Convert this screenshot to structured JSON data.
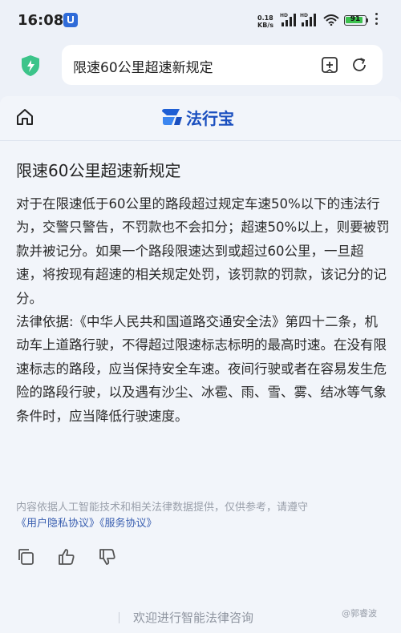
{
  "status_bar": {
    "time": "16:08",
    "net_speed_value": "0.18",
    "net_speed_unit": "KB/s",
    "sim1_label": "HD",
    "sim2_label": "HD",
    "battery_level": "91",
    "battery_fraction": 0.91,
    "battery_color": "#3cc14e"
  },
  "browser": {
    "url_text": "限速60公里超速新规定",
    "security_icon": "shield-check-icon",
    "add_tab_icon": "add-tab-icon",
    "refresh_icon": "refresh-icon"
  },
  "site": {
    "home_icon": "home-icon",
    "logo_text": "法行宝",
    "brand_color": "#1a4fbf"
  },
  "article": {
    "title": "限速60公里超速新规定",
    "paragraphs": [
      "对于在限速低于60公里的路段超过规定车速50%以下的违法行为，交警只警告，不罚款也不会扣分；超速50%以上，则要被罚款并被记分。如果一个路段限速达到或超过60公里，一旦超速，将按现有超速的相关规定处罚，该罚款的罚款，该记分的记分。",
      "法律依据:《中华人民共和国道路交通安全法》第四十二条，机动车上道路行驶，不得超过限速标志标明的最高时速。在没有限速标志的路段，应当保持安全车速。夜间行驶或者在容易发生危险的路段行驶，以及遇有沙尘、冰雹、雨、雪、雾、结冰等气象条件时，应当降低行驶速度。"
    ]
  },
  "disclaimer": {
    "text": "内容依据人工智能技术和相关法律数据提供，仅供参考，请遵守",
    "links": "《用户隐私协议》《服务协议》"
  },
  "actions": {
    "copy_icon": "copy-icon",
    "like_icon": "thumbs-up-icon",
    "dislike_icon": "thumbs-down-icon"
  },
  "bottom": {
    "hint": "欢迎进行智能法律咨询",
    "watermark": "@郭睿波"
  }
}
